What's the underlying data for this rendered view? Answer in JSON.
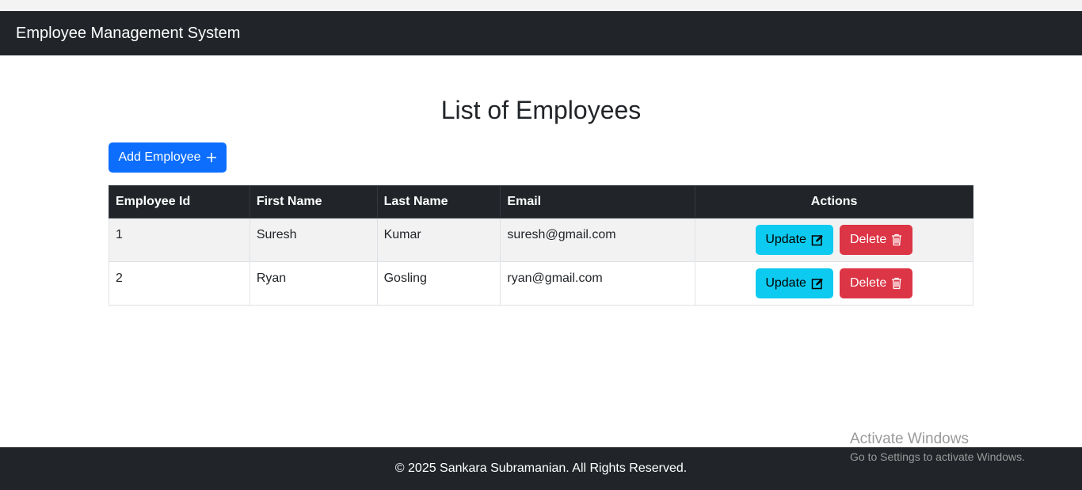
{
  "navbar": {
    "brand": "Employee Management System"
  },
  "main": {
    "title": "List of Employees",
    "add_button_label": "Add Employee",
    "add_button_icon": "plus-icon"
  },
  "table": {
    "headers": [
      "Employee Id",
      "First Name",
      "Last Name",
      "Email",
      "Actions"
    ],
    "rows": [
      {
        "id": "1",
        "first_name": "Suresh",
        "last_name": "Kumar",
        "email": "suresh@gmail.com"
      },
      {
        "id": "2",
        "first_name": "Ryan",
        "last_name": "Gosling",
        "email": "ryan@gmail.com"
      }
    ],
    "update_label": "Update",
    "update_icon": "edit-icon",
    "delete_label": "Delete",
    "delete_icon": "trash-icon"
  },
  "watermark": {
    "title": "Activate Windows",
    "subtitle": "Go to Settings to activate Windows."
  },
  "footer": {
    "text": "© 2025 Sankara Subramanian. All Rights Reserved."
  },
  "colors": {
    "navbar_bg": "#212529",
    "primary": "#0d6efd",
    "info": "#0dcaf0",
    "danger": "#dc3545"
  }
}
